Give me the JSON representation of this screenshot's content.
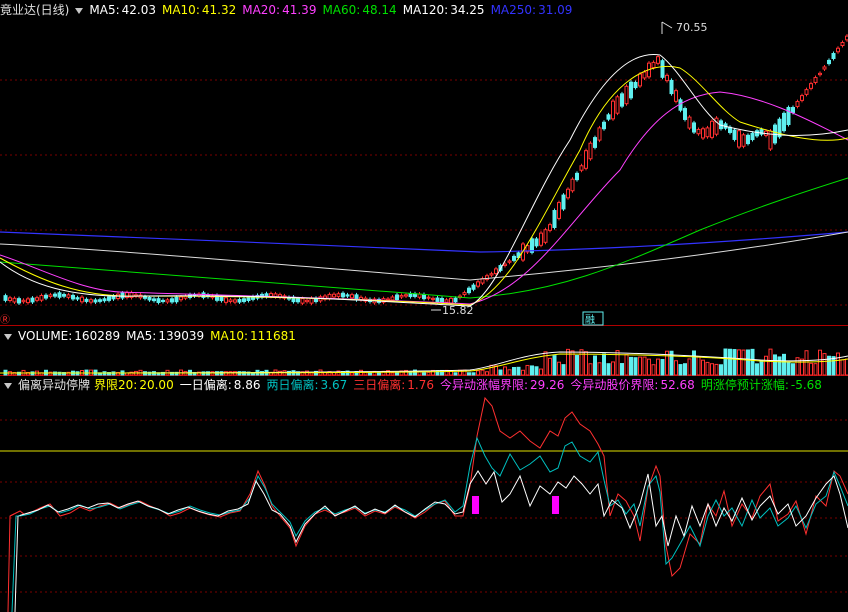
{
  "main": {
    "title": "竟业达(日线)",
    "ma": [
      {
        "label": "MA5:",
        "value": "42.03",
        "color": "#ffffff"
      },
      {
        "label": "MA10:",
        "value": "41.32",
        "color": "#ffff00"
      },
      {
        "label": "MA20:",
        "value": "41.39",
        "color": "#ff40ff"
      },
      {
        "label": "MA60:",
        "value": "48.14",
        "color": "#00e000"
      },
      {
        "label": "MA120:",
        "value": "34.25",
        "color": "#ffffff"
      },
      {
        "label": "MA250:",
        "value": "31.09",
        "color": "#3333ff"
      }
    ],
    "high_label": "70.55",
    "low_label": "15.82",
    "tag_label": "融",
    "left_marker": "Ⓡ"
  },
  "volume": {
    "items": [
      {
        "label": "VOLUME:",
        "value": "160289",
        "color": "#ffffff"
      },
      {
        "label": "MA5:",
        "value": "139039",
        "color": "#ffffff"
      },
      {
        "label": "MA10:",
        "value": "111681",
        "color": "#ffff00"
      }
    ]
  },
  "indicator": {
    "name": "偏离异动停牌",
    "items": [
      {
        "label": "界限20:",
        "value": "20.00",
        "color": "#ffff00"
      },
      {
        "label": "一日偏离:",
        "value": "8.86",
        "color": "#ffffff"
      },
      {
        "label": "两日偏离:",
        "value": "3.67",
        "color": "#00c0c0"
      },
      {
        "label": "三日偏离:",
        "value": "1.76",
        "color": "#ff3030"
      },
      {
        "label": "今异动涨幅界限:",
        "value": "29.26",
        "color": "#ff40ff"
      },
      {
        "label": "今异动股价界限:",
        "value": "52.68",
        "color": "#ff40ff"
      },
      {
        "label": "明涨停预计涨幅:",
        "value": "-5.68",
        "color": "#00e000"
      }
    ]
  },
  "colors": {
    "up": "#ff3030",
    "down": "#5ff0f0",
    "grid": "#7a0000",
    "divider": "#b00000",
    "ma5": "#ffffff",
    "ma10": "#ffff00",
    "ma20": "#ff40ff",
    "ma60": "#00e000",
    "ma250": "#3333ff"
  }
}
